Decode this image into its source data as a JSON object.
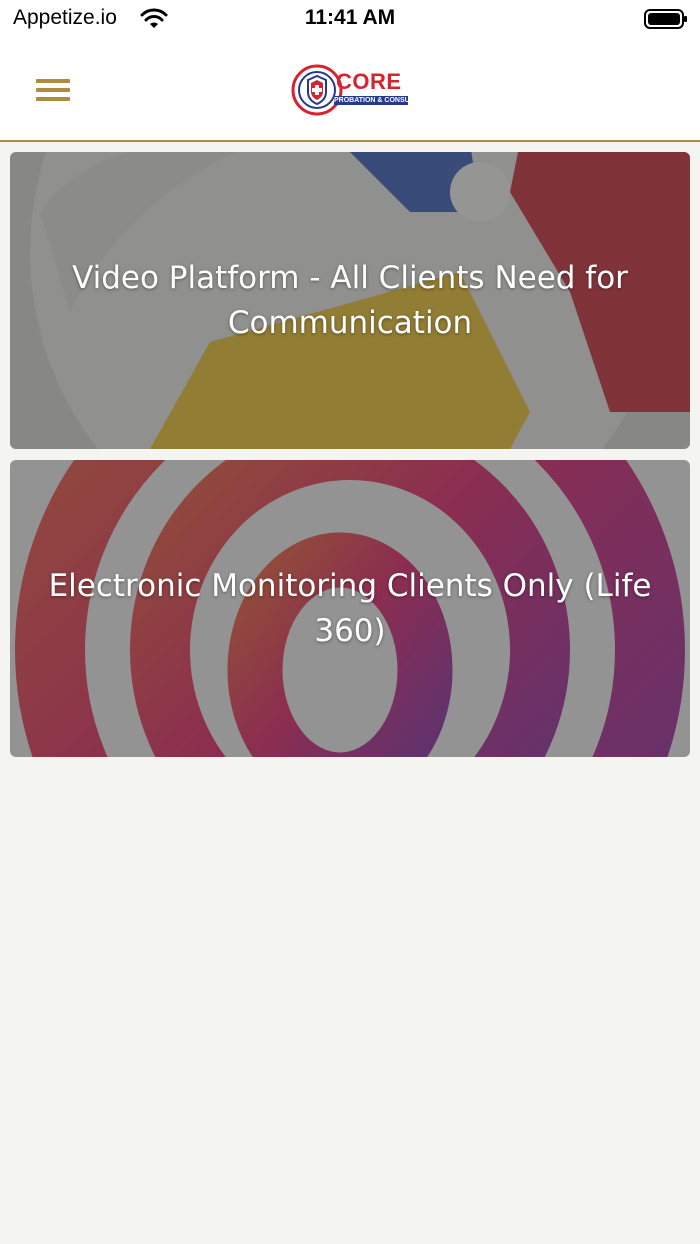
{
  "status_bar": {
    "carrier": "Appetize.io",
    "time": "11:41 AM",
    "wifi_icon": "wifi-icon",
    "battery_icon": "battery-icon"
  },
  "header": {
    "menu_icon": "hamburger-menu-icon",
    "logo": {
      "text": "CORE",
      "subtext": "PROBATION & CONSULTING"
    },
    "accent_color": "#b08a3e"
  },
  "cards": [
    {
      "title": "Video Platform - All Clients Need for Communication"
    },
    {
      "title": "Electronic Monitoring Clients Only (Life 360)"
    }
  ],
  "colors": {
    "background": "#f4f4f0",
    "accent": "#b08a3e",
    "logo_red": "#d52330",
    "logo_blue": "#233b8a"
  }
}
